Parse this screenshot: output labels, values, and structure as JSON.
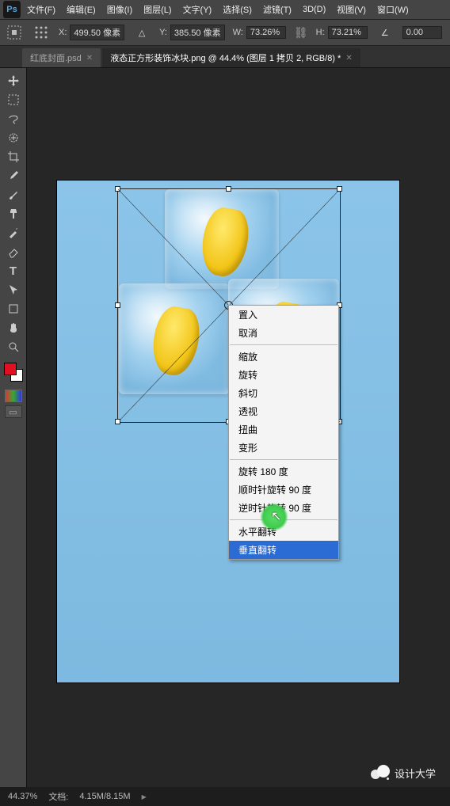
{
  "menu": {
    "items": [
      "文件(F)",
      "编辑(E)",
      "图像(I)",
      "图层(L)",
      "文字(Y)",
      "选择(S)",
      "滤镜(T)",
      "3D(D)",
      "视图(V)",
      "窗口(W)"
    ]
  },
  "options": {
    "x_label": "X:",
    "x_value": "499.50 像素",
    "y_label": "Y:",
    "y_value": "385.50 像素",
    "w_label": "W:",
    "w_value": "73.26%",
    "h_label": "H:",
    "h_value": "73.21%",
    "angle_value": "0.00"
  },
  "tabs": {
    "items": [
      {
        "label": "红底封面.psd",
        "active": false
      },
      {
        "label": "液态正方形装饰冰块.png @ 44.4% (图层 1 拷贝 2, RGB/8) *",
        "active": true
      }
    ]
  },
  "tools": {
    "names": [
      "move",
      "rect-marquee",
      "lasso",
      "quick-select",
      "crop",
      "eyedropper",
      "brush",
      "clone",
      "history-brush",
      "eraser",
      "type",
      "path-select",
      "shape",
      "hand",
      "zoom"
    ]
  },
  "context_menu": {
    "groups": [
      [
        "置入",
        "取消"
      ],
      [
        "缩放",
        "旋转",
        "斜切",
        "透视",
        "扭曲",
        "变形"
      ],
      [
        "旋转 180 度",
        "顺时针旋转 90 度",
        "逆时针旋转 90 度"
      ],
      [
        "水平翻转",
        "垂直翻转"
      ]
    ],
    "selected": "垂直翻转"
  },
  "footer": {
    "zoom": "44.37%",
    "doc_label": "文档:",
    "doc_value": "4.15M/8.15M"
  },
  "watermark": "设计大学"
}
